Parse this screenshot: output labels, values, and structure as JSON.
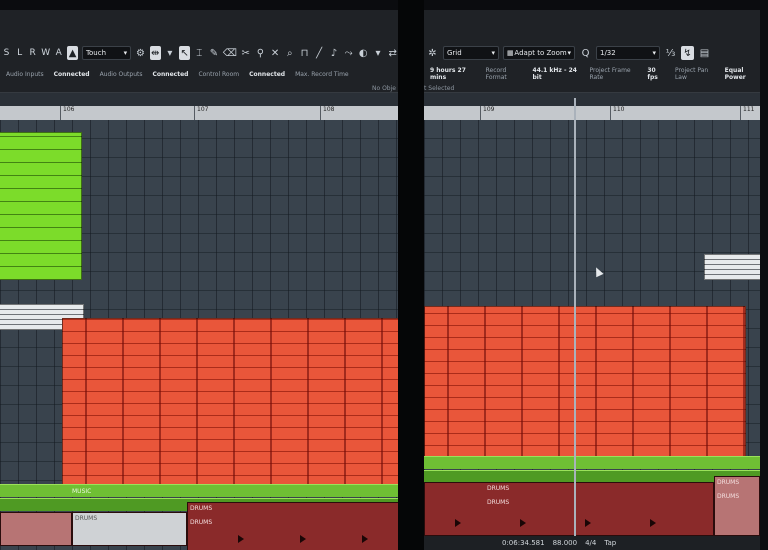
{
  "left_screen": {
    "mode_buttons": [
      "S",
      "L",
      "R",
      "W",
      "A"
    ],
    "automation_mode": "Touch",
    "io_status": [
      {
        "label": "Audio Inputs",
        "value": "Connected"
      },
      {
        "label": "Audio Outputs",
        "value": "Connected"
      },
      {
        "label": "Control Room",
        "value": "Connected"
      },
      {
        "label": "Max. Record Time",
        "value": ""
      }
    ],
    "no_object_text": "No Obje",
    "ruler_labels": [
      "106",
      "107",
      "108"
    ],
    "track_label_music": "MUSIC",
    "track_labels_drums": [
      "DRUMS",
      "DRUMS",
      "DRUMS"
    ]
  },
  "right_screen": {
    "grid_mode": "Grid",
    "adapt_zoom": "Adapt to Zoom",
    "quantize": "1/32",
    "project_info": [
      {
        "label": "9 hours 27 mins",
        "value": ""
      },
      {
        "label": "Record Format",
        "value": "44.1 kHz - 24 bit"
      },
      {
        "label": "Project Frame Rate",
        "value": "30 fps"
      },
      {
        "label": "Project Pan Law",
        "value": "Equal Power"
      }
    ],
    "selected_text": "t Selected",
    "ruler_labels": [
      "109",
      "110",
      "111"
    ],
    "track_labels_drums": [
      "DRUMS",
      "DRUMS",
      "DRUMS",
      "DRUMS"
    ],
    "status_time": "0:06:34.581",
    "status_tempo": "88.000",
    "status_signature": "4/4",
    "status_mode": "Tap"
  },
  "colors": {
    "accent_green": "#7cdc2a",
    "accent_red": "#e9563a",
    "drums_track": "#8a2a2a"
  }
}
